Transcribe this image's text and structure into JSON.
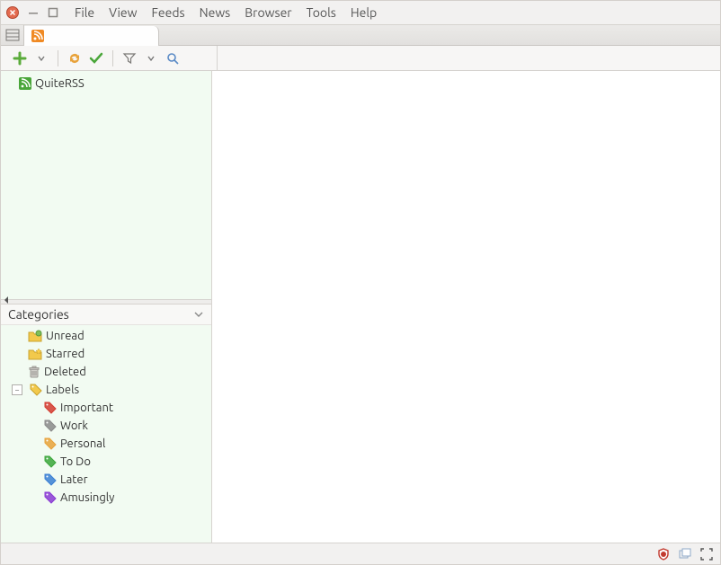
{
  "menu": {
    "items": [
      "File",
      "View",
      "Feeds",
      "News",
      "Browser",
      "Tools",
      "Help"
    ]
  },
  "feeds": [
    {
      "name": "QuiteRSS"
    }
  ],
  "categories": {
    "title": "Categories",
    "items": [
      {
        "key": "unread",
        "label": "Unread"
      },
      {
        "key": "starred",
        "label": "Starred"
      },
      {
        "key": "deleted",
        "label": "Deleted"
      }
    ],
    "labels_header": "Labels",
    "labels": [
      {
        "label": "Important",
        "color": "#d43a2f"
      },
      {
        "label": "Work",
        "color": "#8a8a8a"
      },
      {
        "label": "Personal",
        "color": "#e8a23a"
      },
      {
        "label": "To Do",
        "color": "#3aa63a"
      },
      {
        "label": "Later",
        "color": "#3a7fd4"
      },
      {
        "label": "Amusingly",
        "color": "#8a3ad4"
      }
    ]
  }
}
